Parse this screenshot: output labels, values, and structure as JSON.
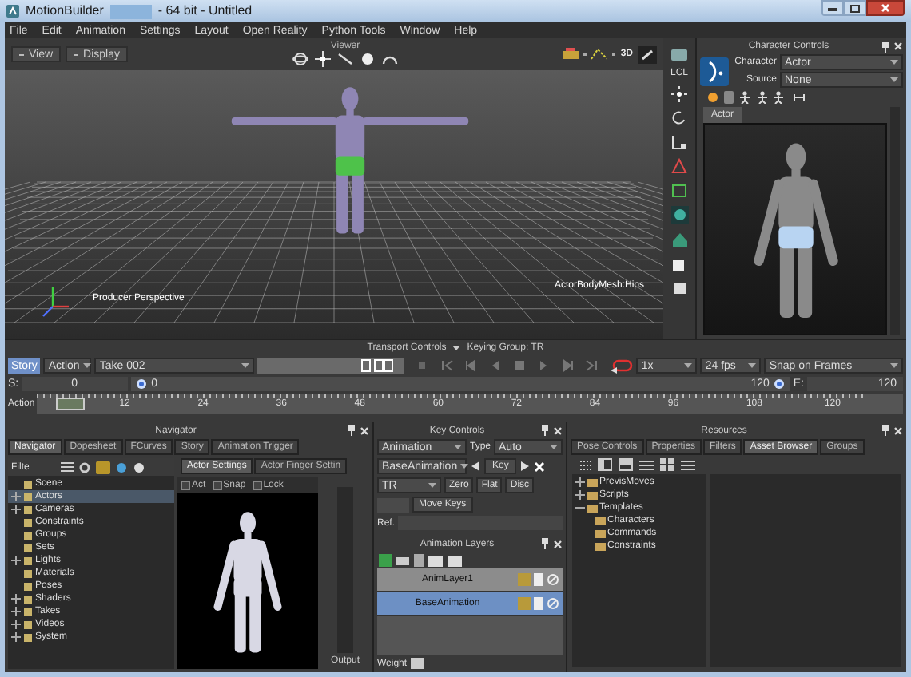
{
  "window": {
    "title": "MotionBuilder",
    "subtitle": "- 64 bit - Untitled"
  },
  "menu": [
    "File",
    "Edit",
    "Animation",
    "Settings",
    "Layout",
    "Open Reality",
    "Python Tools",
    "Window",
    "Help"
  ],
  "viewer": {
    "title": "Viewer",
    "buttons": [
      "View",
      "Display"
    ],
    "tool_label": "3D",
    "camera_label": "Producer Perspective",
    "object_label": "ActorBodyMesh:Hips"
  },
  "character_controls": {
    "title": "Character Controls",
    "fields": [
      {
        "label": "Character",
        "value": "Actor"
      },
      {
        "label": "Source",
        "value": "None"
      }
    ],
    "tab": "Actor",
    "side_label": "LCL"
  },
  "transport": {
    "title": "Transport Controls",
    "keying_group": "Keying Group: TR",
    "story": {
      "label": "Story",
      "on": true
    },
    "action": "Action",
    "take": "Take 002",
    "speed": "1x",
    "fps": "24 fps",
    "snap": "Snap on Frames",
    "start_label": "S:",
    "start": "0",
    "range_start": "0",
    "range_end": "120",
    "end_label": "E:",
    "end": "120",
    "track_label": "Action",
    "ticks": [
      "12",
      "24",
      "36",
      "48",
      "60",
      "72",
      "84",
      "96",
      "108",
      "120"
    ]
  },
  "navigator": {
    "title": "Navigator",
    "tabs": [
      {
        "label": "Navigator",
        "selected": true
      },
      {
        "label": "Dopesheet",
        "selected": false
      },
      {
        "label": "FCurves",
        "selected": false
      },
      {
        "label": "Story",
        "selected": false
      },
      {
        "label": "Animation Trigger",
        "selected": false
      }
    ],
    "filter": "Filte",
    "tree": [
      {
        "label": "Scene",
        "expandable": false,
        "selected": false
      },
      {
        "label": "Actors",
        "expandable": true,
        "selected": true
      },
      {
        "label": "Cameras",
        "expandable": true,
        "selected": false
      },
      {
        "label": "Constraints",
        "expandable": false,
        "selected": false
      },
      {
        "label": "Groups",
        "expandable": false,
        "selected": false
      },
      {
        "label": "Sets",
        "expandable": false,
        "selected": false
      },
      {
        "label": "Lights",
        "expandable": true,
        "selected": false
      },
      {
        "label": "Materials",
        "expandable": false,
        "selected": false
      },
      {
        "label": "Poses",
        "expandable": false,
        "selected": false
      },
      {
        "label": "Shaders",
        "expandable": true,
        "selected": false
      },
      {
        "label": "Takes",
        "expandable": true,
        "selected": false
      },
      {
        "label": "Videos",
        "expandable": true,
        "selected": false
      },
      {
        "label": "System",
        "expandable": true,
        "selected": false
      }
    ],
    "settings_tabs": [
      {
        "label": "Actor Settings",
        "selected": true
      },
      {
        "label": "Actor Finger Settin",
        "selected": false
      }
    ],
    "checks": [
      {
        "label": "Act",
        "checked": false
      },
      {
        "label": "Snap",
        "checked": false
      },
      {
        "label": "Lock",
        "checked": false
      }
    ],
    "output_label": "Output"
  },
  "key_controls": {
    "title": "Key Controls",
    "mode": "Animation",
    "type_label": "Type",
    "type": "Auto",
    "layer": "BaseAnimation",
    "key_button": "Key",
    "group": "TR",
    "buttons": [
      "Zero",
      "Flat",
      "Disc"
    ],
    "move_keys": "Move Keys",
    "ref_label": "Ref."
  },
  "animation_layers": {
    "title": "Animation Layers",
    "layers": [
      {
        "name": "AnimLayer1",
        "selected": false
      },
      {
        "name": "BaseAnimation",
        "selected": true
      }
    ],
    "weight_label": "Weight"
  },
  "resources": {
    "title": "Resources",
    "tabs": [
      {
        "label": "Pose Controls",
        "selected": false
      },
      {
        "label": "Properties",
        "selected": false
      },
      {
        "label": "Filters",
        "selected": false
      },
      {
        "label": "Asset Browser",
        "selected": true
      },
      {
        "label": "Groups",
        "selected": false
      }
    ],
    "tree": [
      {
        "label": "PrevisMoves",
        "expanded": false
      },
      {
        "label": "Scripts",
        "expanded": false
      },
      {
        "label": "Templates",
        "expanded": true,
        "children": [
          {
            "label": "Characters"
          },
          {
            "label": "Commands"
          },
          {
            "label": "Constraints"
          }
        ]
      }
    ]
  }
}
